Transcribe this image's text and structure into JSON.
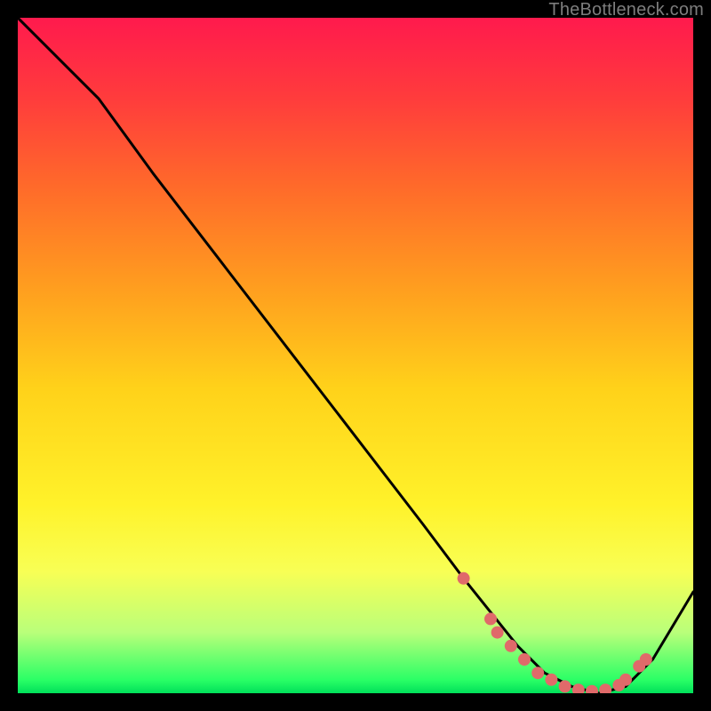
{
  "credit": "TheBottleneck.com",
  "colors": {
    "background": "#000000",
    "gradient_top": "#ff1a4d",
    "gradient_mid": "#ffd21a",
    "gradient_bottom": "#00e05a",
    "curve": "#000000",
    "dots": "#e06a6a"
  },
  "chart_data": {
    "type": "line",
    "title": "",
    "xlabel": "",
    "ylabel": "",
    "xlim": [
      0,
      100
    ],
    "ylim": [
      0,
      100
    ],
    "series": [
      {
        "name": "bottleneck-curve",
        "x": [
          0,
          8,
          12,
          20,
          30,
          40,
          50,
          60,
          66,
          70,
          74,
          78,
          82,
          86,
          90,
          94,
          100
        ],
        "y": [
          100,
          92,
          88,
          77,
          64,
          51,
          38,
          25,
          17,
          12,
          7,
          3,
          1,
          0,
          1,
          5,
          15
        ]
      }
    ],
    "dots": {
      "name": "highlighted-points",
      "x": [
        66,
        70,
        71,
        73,
        75,
        77,
        79,
        81,
        83,
        85,
        87,
        89,
        90,
        92,
        93
      ],
      "y": [
        17,
        11,
        9,
        7,
        5,
        3,
        2,
        1,
        0.5,
        0.3,
        0.5,
        1.2,
        2,
        4,
        5
      ]
    }
  }
}
